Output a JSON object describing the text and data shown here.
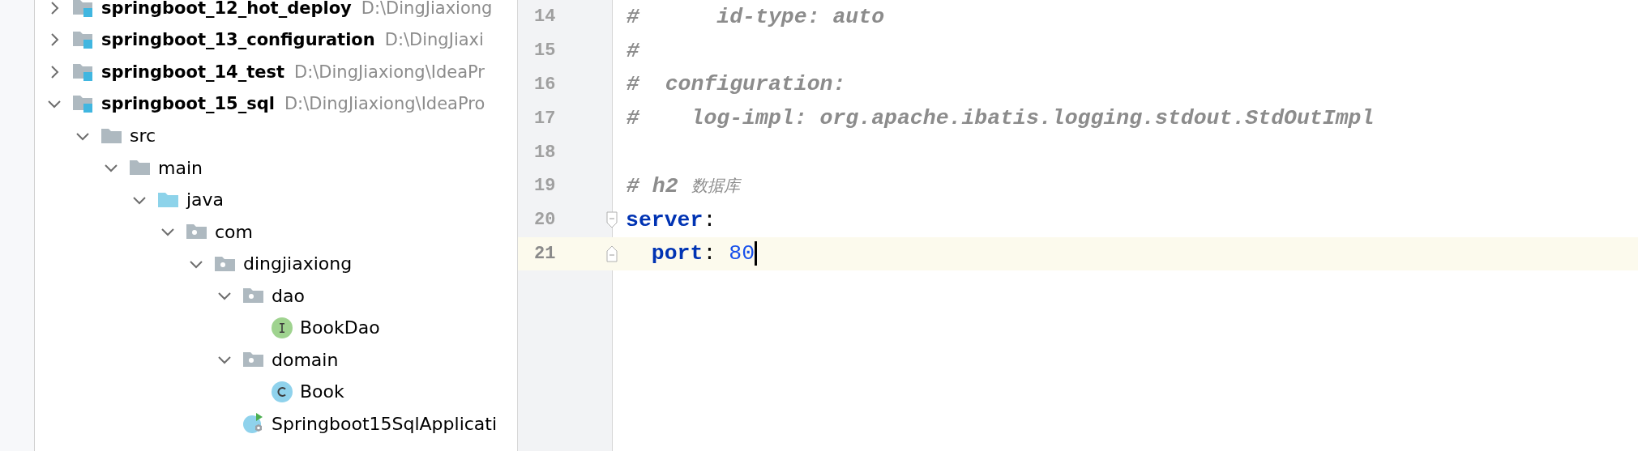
{
  "project_tree": [
    {
      "label": "springboot_12_hot_deploy",
      "path": "D:\\DingJiaxiong",
      "kind": "project",
      "expanded": false
    },
    {
      "label": "springboot_13_configuration",
      "path": "D:\\DingJiaxi",
      "kind": "project",
      "expanded": false
    },
    {
      "label": "springboot_14_test",
      "path": "D:\\DingJiaxiong\\IdeaPr",
      "kind": "project",
      "expanded": false
    },
    {
      "label": "springboot_15_sql",
      "path": "D:\\DingJiaxiong\\IdeaPro",
      "kind": "project",
      "expanded": true,
      "children": [
        {
          "label": "src",
          "kind": "folder",
          "expanded": true,
          "children": [
            {
              "label": "main",
              "kind": "folder",
              "expanded": true,
              "children": [
                {
                  "label": "java",
                  "kind": "source-folder",
                  "expanded": true,
                  "children": [
                    {
                      "label": "com",
                      "kind": "package",
                      "expanded": true,
                      "children": [
                        {
                          "label": "dingjiaxiong",
                          "kind": "package",
                          "expanded": true,
                          "children": [
                            {
                              "label": "dao",
                              "kind": "package",
                              "expanded": true,
                              "children": [
                                {
                                  "label": "BookDao",
                                  "kind": "interface"
                                }
                              ]
                            },
                            {
                              "label": "domain",
                              "kind": "package",
                              "expanded": true,
                              "children": [
                                {
                                  "label": "Book",
                                  "kind": "class"
                                }
                              ]
                            },
                            {
                              "label": "Springboot15SqlApplicati",
                              "kind": "spring-app"
                            }
                          ]
                        }
                      ]
                    }
                  ]
                }
              ]
            }
          ]
        }
      ]
    }
  ],
  "editor": {
    "lines": [
      {
        "number": "14",
        "current": false,
        "tokens": [
          {
            "kind": "comment",
            "text": "#      id-type: auto"
          }
        ]
      },
      {
        "number": "15",
        "current": false,
        "tokens": [
          {
            "kind": "comment",
            "text": "#"
          }
        ]
      },
      {
        "number": "16",
        "current": false,
        "tokens": [
          {
            "kind": "comment",
            "text": "#  configuration:"
          }
        ]
      },
      {
        "number": "17",
        "current": false,
        "tokens": [
          {
            "kind": "comment",
            "text": "#    log-impl: org.apache.ibatis.logging.stdout.StdOutImpl"
          }
        ]
      },
      {
        "number": "18",
        "current": false
      },
      {
        "number": "19",
        "current": false,
        "tokens": [
          {
            "kind": "comment",
            "text": "# h2 "
          },
          {
            "kind": "cjk-comment",
            "text": "数据库"
          }
        ]
      },
      {
        "number": "20",
        "current": false,
        "kind": "block-start",
        "tokens": [
          {
            "kind": "key",
            "text": "server"
          },
          {
            "kind": "punct",
            "text": ":"
          }
        ]
      },
      {
        "number": "21",
        "current": true,
        "kind": "block-end",
        "caret": true,
        "tokens": [
          {
            "kind": "key",
            "text": "  port"
          },
          {
            "kind": "punct",
            "text": ": "
          },
          {
            "kind": "number",
            "text": "80"
          }
        ]
      }
    ]
  }
}
